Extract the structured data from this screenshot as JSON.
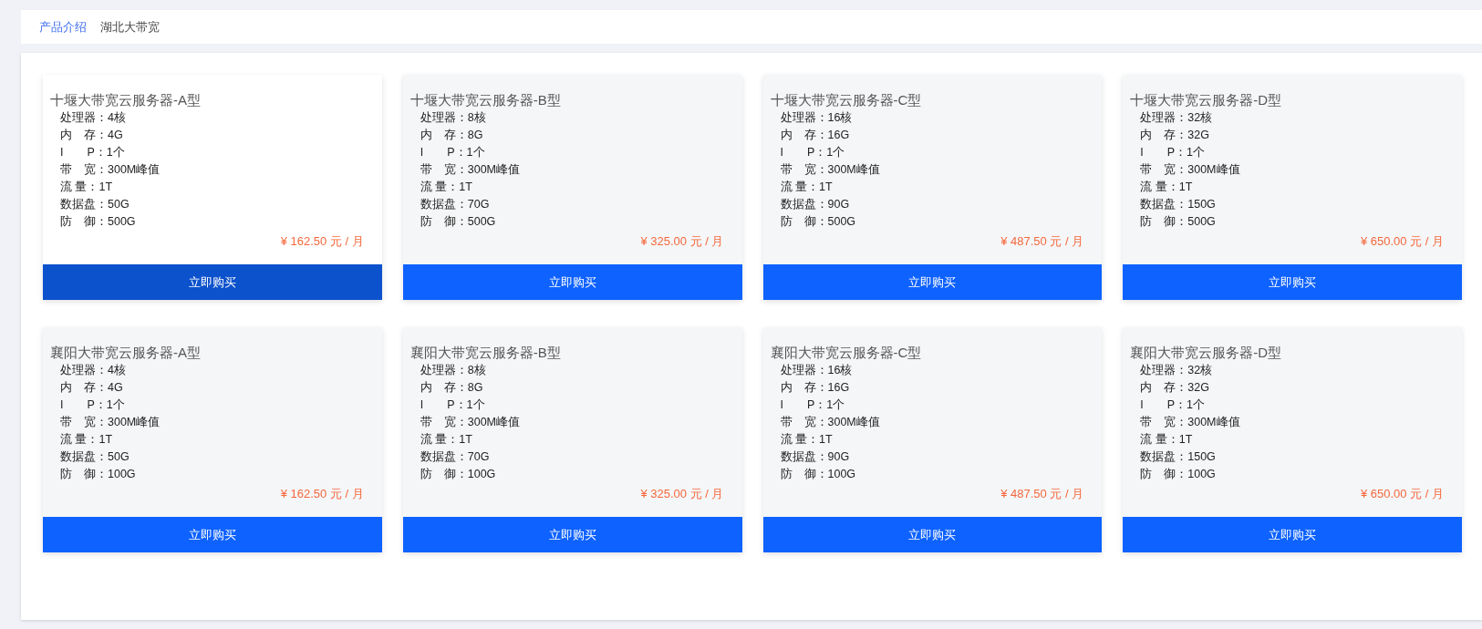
{
  "breadcrumb": [
    {
      "label": "产品介绍",
      "selected": false
    },
    {
      "label": "湖北大带宽",
      "selected": true
    }
  ],
  "products": [
    {
      "title": "十堰大带宽云服务器-A型",
      "highlighted": true,
      "specs": [
        "处理器：4核",
        "内　存：4G",
        "I　　P：1个",
        "带　宽：300M峰值",
        "流 量：1T",
        "数据盘：50G",
        "防　御：500G"
      ],
      "price": "¥ 162.50 元 / 月",
      "button": "立即购买"
    },
    {
      "title": "十堰大带宽云服务器-B型",
      "highlighted": false,
      "specs": [
        "处理器：8核",
        "内　存：8G",
        "I　　P：1个",
        "带　宽：300M峰值",
        "流 量：1T",
        "数据盘：70G",
        "防　御：500G"
      ],
      "price": "¥ 325.00 元 / 月",
      "button": "立即购买"
    },
    {
      "title": "十堰大带宽云服务器-C型",
      "highlighted": false,
      "specs": [
        "处理器：16核",
        "内　存：16G",
        "I　　P：1个",
        "带　宽：300M峰值",
        "流 量：1T",
        "数据盘：90G",
        "防　御：500G"
      ],
      "price": "¥ 487.50 元 / 月",
      "button": "立即购买"
    },
    {
      "title": "十堰大带宽云服务器-D型",
      "highlighted": false,
      "specs": [
        "处理器：32核",
        "内　存：32G",
        "I　　P：1个",
        "带　宽：300M峰值",
        "流 量：1T",
        "数据盘：150G",
        "防　御：500G"
      ],
      "price": "¥ 650.00 元 / 月",
      "button": "立即购买"
    },
    {
      "title": "襄阳大带宽云服务器-A型",
      "highlighted": false,
      "specs": [
        "处理器：4核",
        "内　存：4G",
        "I　　P：1个",
        "带　宽：300M峰值",
        "流 量：1T",
        "数据盘：50G",
        "防　御：100G"
      ],
      "price": "¥ 162.50 元 / 月",
      "button": "立即购买"
    },
    {
      "title": "襄阳大带宽云服务器-B型",
      "highlighted": false,
      "specs": [
        "处理器：8核",
        "内　存：8G",
        "I　　P：1个",
        "带　宽：300M峰值",
        "流 量：1T",
        "数据盘：70G",
        "防　御：100G"
      ],
      "price": "¥ 325.00 元 / 月",
      "button": "立即购买"
    },
    {
      "title": "襄阳大带宽云服务器-C型",
      "highlighted": false,
      "specs": [
        "处理器：16核",
        "内　存：16G",
        "I　　P：1个",
        "带　宽：300M峰值",
        "流 量：1T",
        "数据盘：90G",
        "防　御：100G"
      ],
      "price": "¥ 487.50 元 / 月",
      "button": "立即购买"
    },
    {
      "title": "襄阳大带宽云服务器-D型",
      "highlighted": false,
      "specs": [
        "处理器：32核",
        "内　存：32G",
        "I　　P：1个",
        "带　宽：300M峰值",
        "流 量：1T",
        "数据盘：150G",
        "防　御：100G"
      ],
      "price": "¥ 650.00 元 / 月",
      "button": "立即购买"
    }
  ]
}
